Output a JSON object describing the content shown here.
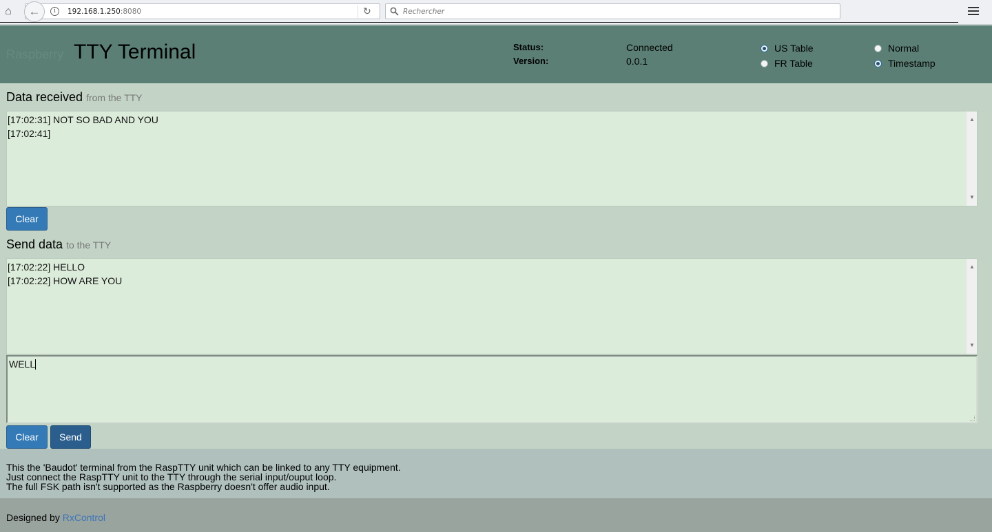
{
  "browser": {
    "url_host": "192.168.1.250",
    "url_port": ":8080",
    "search_placeholder": "Rechercher"
  },
  "header": {
    "brand_prefix": "Raspberry",
    "title": "TTY Terminal",
    "status_label": "Status:",
    "status_value": "Connected",
    "version_label": "Version:",
    "version_value": "0.0.1",
    "table_options": [
      "US Table",
      "FR Table"
    ],
    "table_selected": "US Table",
    "mode_options": [
      "Normal",
      "Timestamp"
    ],
    "mode_selected": "Timestamp"
  },
  "received": {
    "title": "Data received",
    "subtitle": "from the TTY",
    "lines": [
      "[17:02:31] NOT SO BAD AND YOU",
      "[17:02:41]"
    ],
    "clear_label": "Clear"
  },
  "send": {
    "title": "Send data",
    "subtitle": "to the TTY",
    "lines": [
      "[17:02:22] HELLO",
      "[17:02:22] HOW ARE YOU"
    ],
    "input_value": "WELL",
    "clear_label": "Clear",
    "send_label": "Send"
  },
  "info": {
    "lines": [
      "This the 'Baudot' terminal from the RaspTTY unit which can be linked to any TTY equipment.",
      "Just connect the RaspTTY unit to the TTY through the serial input/ouput loop.",
      "The full FSK path isn't supported as the Raspberry doesn't offer audio input."
    ]
  },
  "footer": {
    "prefix": "Designed by ",
    "link_text": "RxControl"
  },
  "colors": {
    "header_bg": "#5b7f74",
    "page_bg": "#c3d4c6",
    "textarea_bg": "#dcecda",
    "button_blue": "#337ab7",
    "link": "#3a74b8"
  }
}
